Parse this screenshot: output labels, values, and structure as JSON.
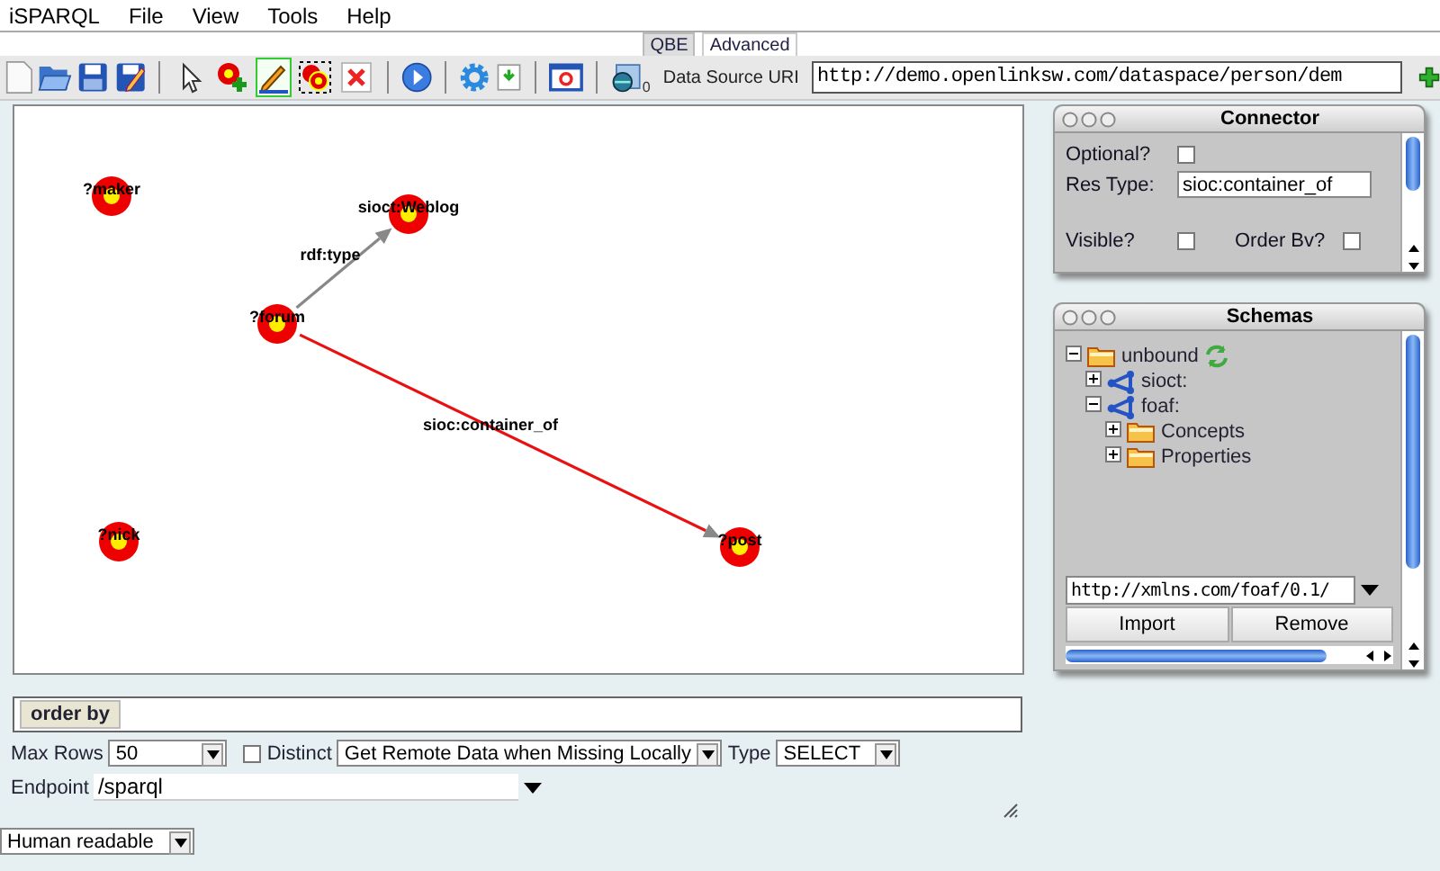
{
  "menu": [
    "iSPARQL",
    "File",
    "View",
    "Tools",
    "Help"
  ],
  "tabs": [
    {
      "label": "QBE",
      "selected": true
    },
    {
      "label": "Advanced",
      "selected": false
    }
  ],
  "toolbar_tools": [
    {
      "selected": false
    },
    {
      "selected": false
    },
    {
      "selected": true
    },
    {
      "selected": false
    },
    {
      "selected": false
    }
  ],
  "data_source": {
    "badge": "0",
    "label": "Data Source URI",
    "value": "http://demo.openlinksw.com/dataspace/person/dem"
  },
  "graph": {
    "nodes": [
      {
        "label": "?maker"
      },
      {
        "label": "sioct:Weblog"
      },
      {
        "label": "?forum"
      },
      {
        "label": "?nick"
      },
      {
        "label": "?post"
      }
    ],
    "edges": [
      {
        "label": "rdf:type",
        "selected": false
      },
      {
        "label": "sioc:container_of",
        "selected": true
      }
    ]
  },
  "connector": {
    "title": "Connector",
    "optional_label": "Optional?",
    "optional": false,
    "res_type_label": "Res Type:",
    "res_type": "sioc:container_of",
    "visible_label": "Visible?",
    "visible": false,
    "order_by_label": "Order Bv?",
    "order_by": false
  },
  "schemas": {
    "title": "Schemas",
    "tree": [
      {
        "label": "unbound",
        "kind": "folder",
        "expanded": true,
        "children": [
          {
            "label": "sioct:",
            "kind": "schema",
            "expanded": false
          },
          {
            "label": "foaf:",
            "kind": "schema",
            "expanded": true,
            "children": [
              {
                "label": "Concepts",
                "kind": "folder",
                "expanded": false
              },
              {
                "label": "Properties",
                "kind": "folder",
                "expanded": false
              }
            ]
          }
        ]
      }
    ],
    "uri": "http://xmlns.com/foaf/0.1/",
    "buttons": [
      "Import",
      "Remove"
    ]
  },
  "order_by": {
    "label": "order by"
  },
  "options": {
    "max_rows_label": "Max Rows",
    "max_rows": "50",
    "distinct_label": "Distinct",
    "distinct": false,
    "fetch_mode": "Get Remote Data when Missing Locally",
    "type_label": "Type",
    "type": "SELECT",
    "endpoint_label": "Endpoint",
    "endpoint": "/sparql"
  },
  "output_format": "Human readable"
}
